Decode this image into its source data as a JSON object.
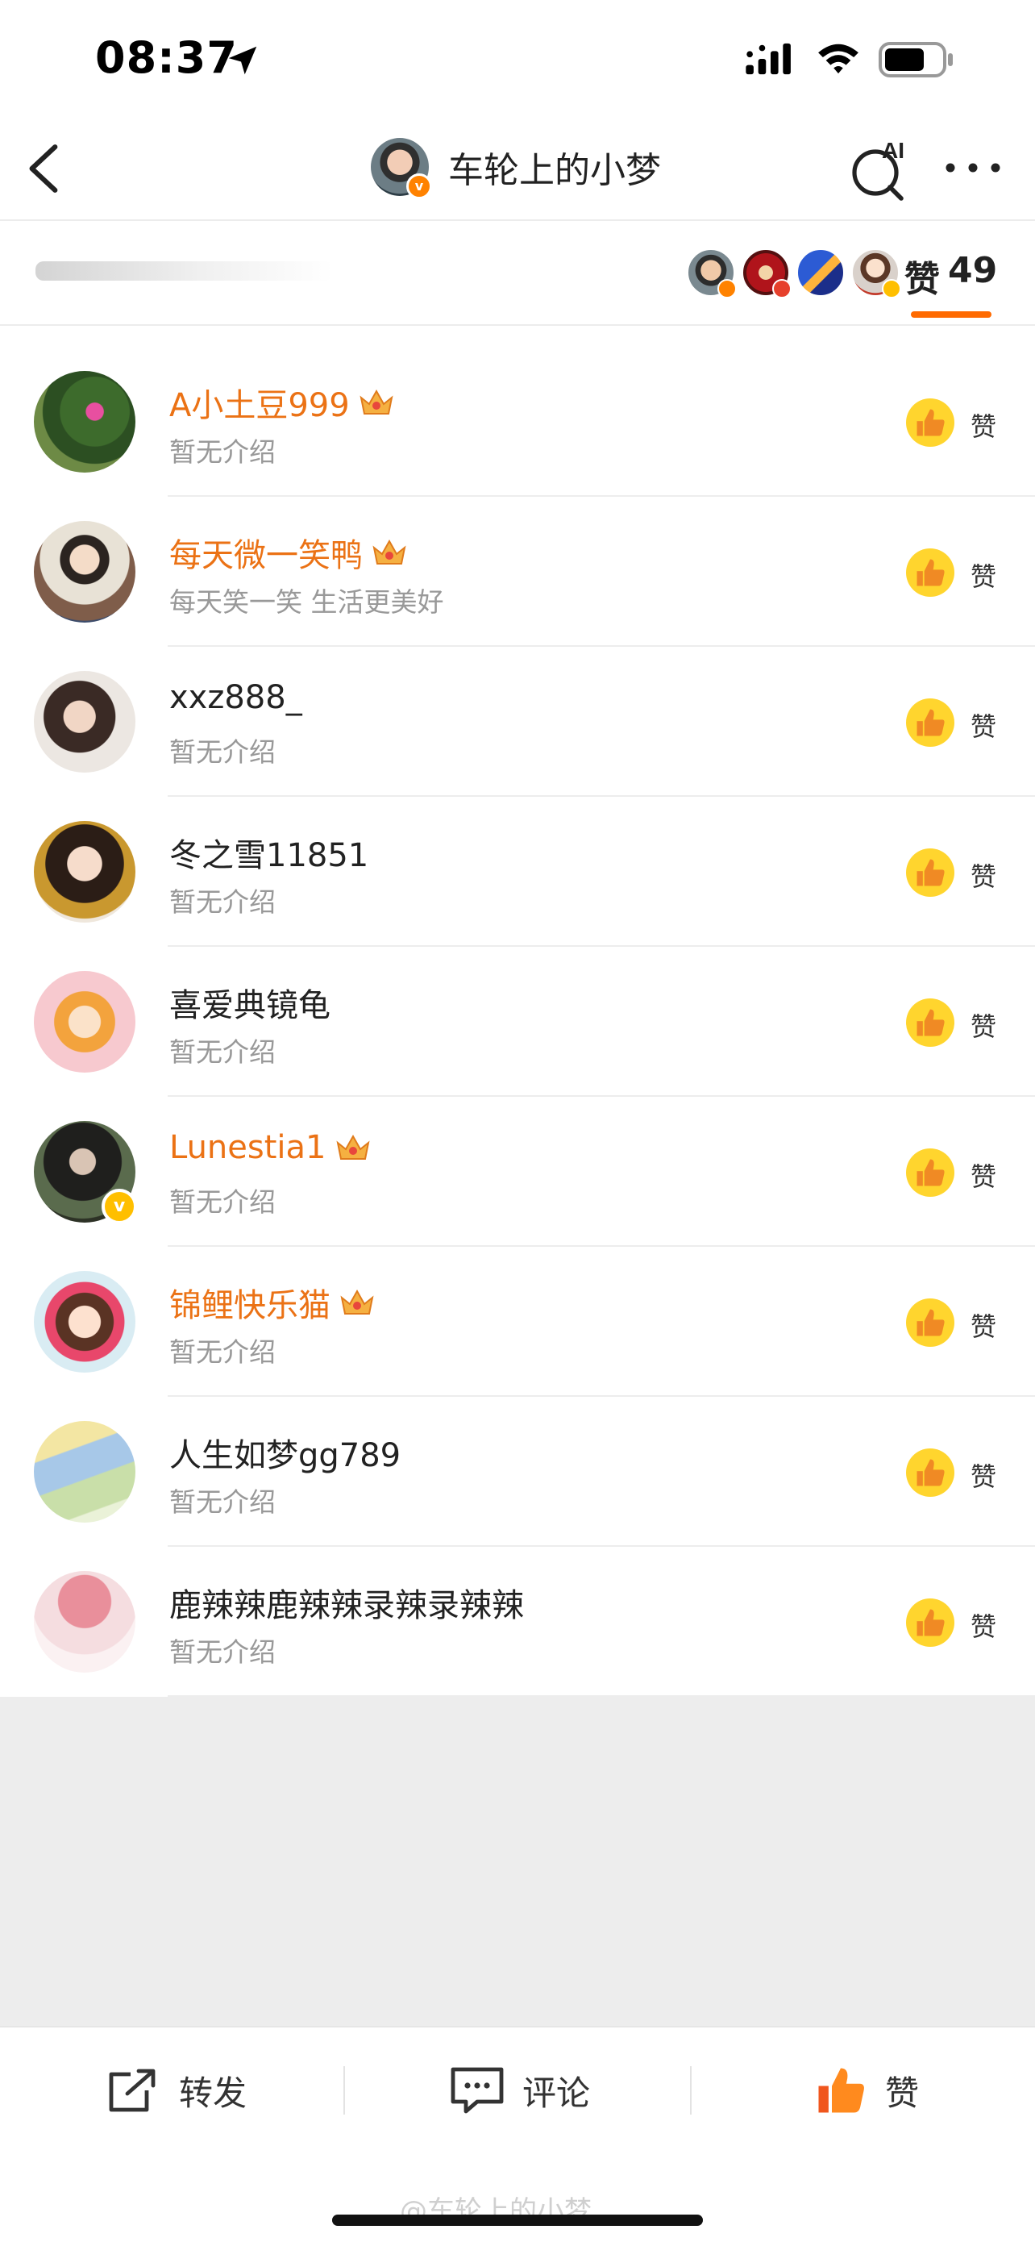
{
  "status_bar": {
    "time": "08:37"
  },
  "nav": {
    "title": "车轮上的小梦",
    "ai_label": "AI"
  },
  "likes_header": {
    "label": "赞",
    "count": "49"
  },
  "users": [
    {
      "name": "A小土豆999",
      "bio": "暂无介绍",
      "vip": true,
      "like_label": "赞"
    },
    {
      "name": "每天微一笑鸭",
      "bio": "每天笑一笑 生活更美好",
      "vip": true,
      "like_label": "赞"
    },
    {
      "name": "xxz888_",
      "bio": "暂无介绍",
      "vip": false,
      "like_label": "赞"
    },
    {
      "name": "冬之雪11851",
      "bio": "暂无介绍",
      "vip": false,
      "like_label": "赞"
    },
    {
      "name": "喜爱典镜龟",
      "bio": "暂无介绍",
      "vip": false,
      "like_label": "赞"
    },
    {
      "name": "Lunestia1",
      "bio": "暂无介绍",
      "vip": true,
      "verified": true,
      "like_label": "赞"
    },
    {
      "name": "锦鲤快乐猫",
      "bio": "暂无介绍",
      "vip": true,
      "like_label": "赞"
    },
    {
      "name": "人生如梦gg789",
      "bio": "暂无介绍",
      "vip": false,
      "like_label": "赞"
    },
    {
      "name": "鹿辣辣鹿辣辣录辣录辣辣",
      "bio": "暂无介绍",
      "vip": false,
      "like_label": "赞"
    }
  ],
  "bottom_bar": {
    "repost": "转发",
    "comment": "评论",
    "like": "赞"
  },
  "watermark": "@车轮上的小梦",
  "colors": {
    "accent": "#ff6a00",
    "vip_name": "#eb7215",
    "like_yellow": "#ffd52e"
  }
}
